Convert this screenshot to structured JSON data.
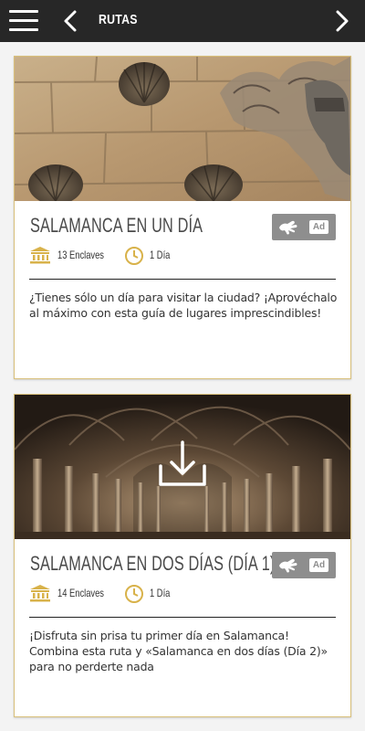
{
  "header": {
    "title": "RUTAS",
    "menu_icon": "hamburger-menu-icon",
    "back_icon": "chevron-left-icon",
    "forward_icon": "chevron-right-icon"
  },
  "routes": [
    {
      "title": "SALAMANCA EN UN DÍA",
      "enclaves": "13 Enclaves",
      "duration": "1 Día",
      "description": "¿Tienes sólo un día para visitar la ciudad? ¡Aprovéchalo al máximo con esta guía de lugares imprescindibles!",
      "badge_ad": "Ad",
      "image": "casa-de-las-conchas-wall"
    },
    {
      "title": "SALAMANCA EN DOS DÍAS (DÍA 1)",
      "enclaves": "14 Enclaves",
      "duration": "1 Día",
      "description": "¡Disfruta sin prisa tu primer día en Salamanca! Combina esta ruta y «Salamanca en dos días (Día 2)» para no perderte nada",
      "badge_ad": "Ad",
      "image": "cloister-gothic-arches",
      "download_icon": "download-icon"
    }
  ],
  "colors": {
    "topbar": "#272727",
    "accent_gold": "#d8b24a",
    "card_border": "#d8bf7a",
    "badge_bg": "#8e8e8e",
    "text": "#4a4a4a"
  }
}
